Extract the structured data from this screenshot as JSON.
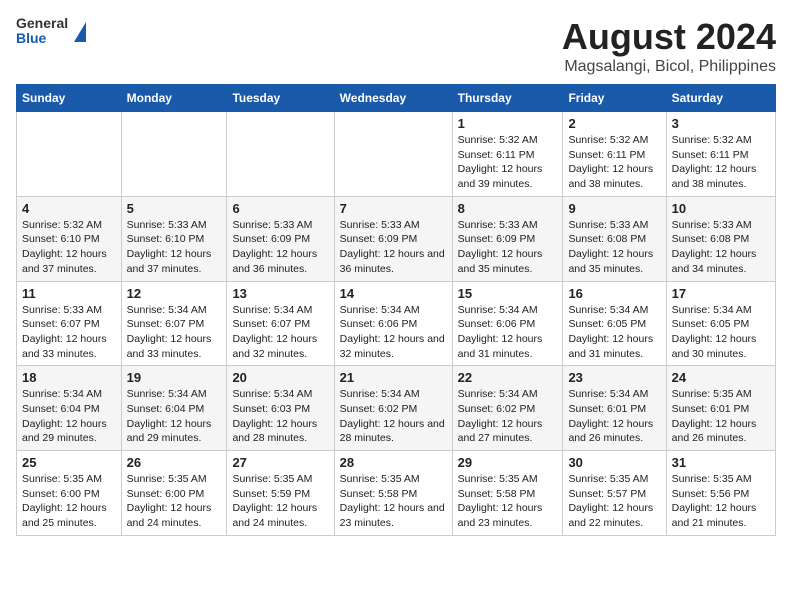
{
  "logo": {
    "general": "General",
    "blue": "Blue"
  },
  "title": "August 2024",
  "subtitle": "Magsalangi, Bicol, Philippines",
  "days_of_week": [
    "Sunday",
    "Monday",
    "Tuesday",
    "Wednesday",
    "Thursday",
    "Friday",
    "Saturday"
  ],
  "weeks": [
    [
      {
        "day": "",
        "info": ""
      },
      {
        "day": "",
        "info": ""
      },
      {
        "day": "",
        "info": ""
      },
      {
        "day": "",
        "info": ""
      },
      {
        "day": "1",
        "sunrise": "5:32 AM",
        "sunset": "6:11 PM",
        "daylight": "12 hours and 39 minutes."
      },
      {
        "day": "2",
        "sunrise": "5:32 AM",
        "sunset": "6:11 PM",
        "daylight": "12 hours and 38 minutes."
      },
      {
        "day": "3",
        "sunrise": "5:32 AM",
        "sunset": "6:11 PM",
        "daylight": "12 hours and 38 minutes."
      }
    ],
    [
      {
        "day": "4",
        "sunrise": "5:32 AM",
        "sunset": "6:10 PM",
        "daylight": "12 hours and 37 minutes."
      },
      {
        "day": "5",
        "sunrise": "5:33 AM",
        "sunset": "6:10 PM",
        "daylight": "12 hours and 37 minutes."
      },
      {
        "day": "6",
        "sunrise": "5:33 AM",
        "sunset": "6:09 PM",
        "daylight": "12 hours and 36 minutes."
      },
      {
        "day": "7",
        "sunrise": "5:33 AM",
        "sunset": "6:09 PM",
        "daylight": "12 hours and 36 minutes."
      },
      {
        "day": "8",
        "sunrise": "5:33 AM",
        "sunset": "6:09 PM",
        "daylight": "12 hours and 35 minutes."
      },
      {
        "day": "9",
        "sunrise": "5:33 AM",
        "sunset": "6:08 PM",
        "daylight": "12 hours and 35 minutes."
      },
      {
        "day": "10",
        "sunrise": "5:33 AM",
        "sunset": "6:08 PM",
        "daylight": "12 hours and 34 minutes."
      }
    ],
    [
      {
        "day": "11",
        "sunrise": "5:33 AM",
        "sunset": "6:07 PM",
        "daylight": "12 hours and 33 minutes."
      },
      {
        "day": "12",
        "sunrise": "5:34 AM",
        "sunset": "6:07 PM",
        "daylight": "12 hours and 33 minutes."
      },
      {
        "day": "13",
        "sunrise": "5:34 AM",
        "sunset": "6:07 PM",
        "daylight": "12 hours and 32 minutes."
      },
      {
        "day": "14",
        "sunrise": "5:34 AM",
        "sunset": "6:06 PM",
        "daylight": "12 hours and 32 minutes."
      },
      {
        "day": "15",
        "sunrise": "5:34 AM",
        "sunset": "6:06 PM",
        "daylight": "12 hours and 31 minutes."
      },
      {
        "day": "16",
        "sunrise": "5:34 AM",
        "sunset": "6:05 PM",
        "daylight": "12 hours and 31 minutes."
      },
      {
        "day": "17",
        "sunrise": "5:34 AM",
        "sunset": "6:05 PM",
        "daylight": "12 hours and 30 minutes."
      }
    ],
    [
      {
        "day": "18",
        "sunrise": "5:34 AM",
        "sunset": "6:04 PM",
        "daylight": "12 hours and 29 minutes."
      },
      {
        "day": "19",
        "sunrise": "5:34 AM",
        "sunset": "6:04 PM",
        "daylight": "12 hours and 29 minutes."
      },
      {
        "day": "20",
        "sunrise": "5:34 AM",
        "sunset": "6:03 PM",
        "daylight": "12 hours and 28 minutes."
      },
      {
        "day": "21",
        "sunrise": "5:34 AM",
        "sunset": "6:02 PM",
        "daylight": "12 hours and 28 minutes."
      },
      {
        "day": "22",
        "sunrise": "5:34 AM",
        "sunset": "6:02 PM",
        "daylight": "12 hours and 27 minutes."
      },
      {
        "day": "23",
        "sunrise": "5:34 AM",
        "sunset": "6:01 PM",
        "daylight": "12 hours and 26 minutes."
      },
      {
        "day": "24",
        "sunrise": "5:35 AM",
        "sunset": "6:01 PM",
        "daylight": "12 hours and 26 minutes."
      }
    ],
    [
      {
        "day": "25",
        "sunrise": "5:35 AM",
        "sunset": "6:00 PM",
        "daylight": "12 hours and 25 minutes."
      },
      {
        "day": "26",
        "sunrise": "5:35 AM",
        "sunset": "6:00 PM",
        "daylight": "12 hours and 24 minutes."
      },
      {
        "day": "27",
        "sunrise": "5:35 AM",
        "sunset": "5:59 PM",
        "daylight": "12 hours and 24 minutes."
      },
      {
        "day": "28",
        "sunrise": "5:35 AM",
        "sunset": "5:58 PM",
        "daylight": "12 hours and 23 minutes."
      },
      {
        "day": "29",
        "sunrise": "5:35 AM",
        "sunset": "5:58 PM",
        "daylight": "12 hours and 23 minutes."
      },
      {
        "day": "30",
        "sunrise": "5:35 AM",
        "sunset": "5:57 PM",
        "daylight": "12 hours and 22 minutes."
      },
      {
        "day": "31",
        "sunrise": "5:35 AM",
        "sunset": "5:56 PM",
        "daylight": "12 hours and 21 minutes."
      }
    ]
  ]
}
